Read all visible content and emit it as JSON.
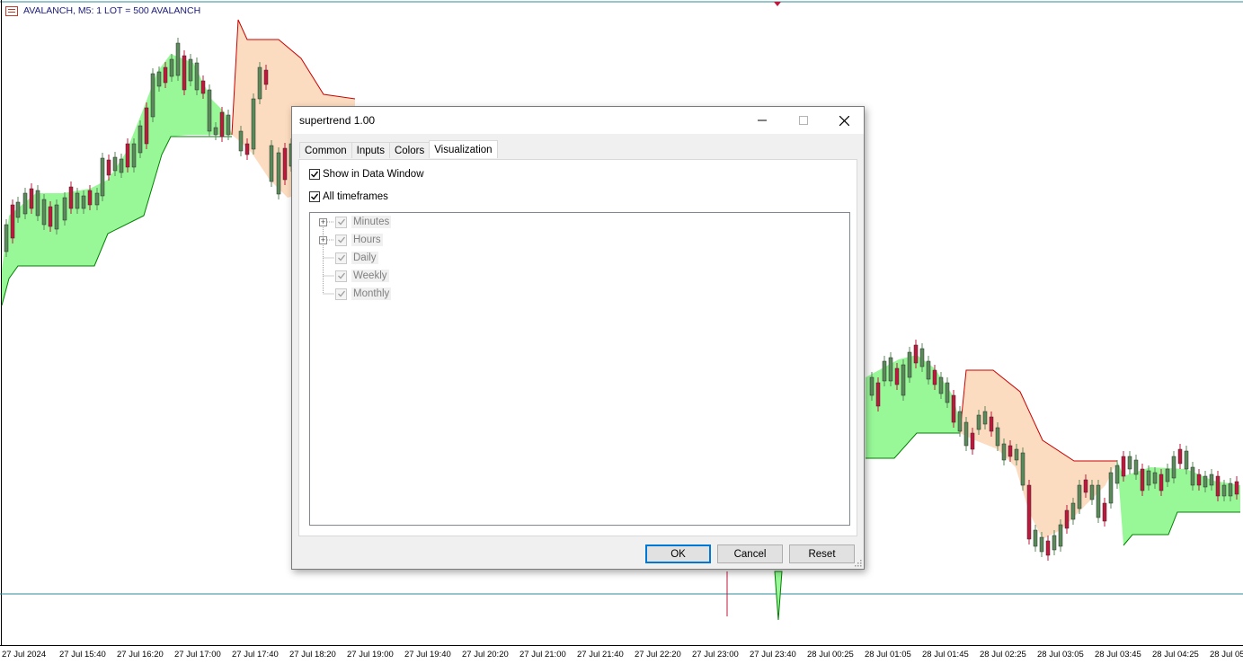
{
  "chart": {
    "title": "AVALANCH, M5:  1 LOT = 500 AVALANCH",
    "time_labels": [
      "27 Jul 2024",
      "27 Jul 15:40",
      "27 Jul 16:20",
      "27 Jul 17:00",
      "27 Jul 17:40",
      "27 Jul 18:20",
      "27 Jul 19:00",
      "27 Jul 19:40",
      "27 Jul 20:20",
      "27 Jul 21:00",
      "27 Jul 21:40",
      "27 Jul 22:20",
      "27 Jul 23:00",
      "27 Jul 23:40",
      "28 Jul 00:25",
      "28 Jul 01:05",
      "28 Jul 01:45",
      "28 Jul 02:25",
      "28 Jul 03:05",
      "28 Jul 03:45",
      "28 Jul 04:25",
      "28 Jul 05"
    ],
    "colors": {
      "up_band": "#98f898",
      "down_band": "#fcdcc0",
      "down_line": "#cc0000",
      "up_line": "#008000",
      "bull_candle": "#5a8a5a",
      "bear_candle": "#c0183c",
      "grid_line": "#2e8b9a"
    }
  },
  "dialog": {
    "title": "supertrend 1.00",
    "tabs": [
      "Common",
      "Inputs",
      "Colors",
      "Visualization"
    ],
    "active_tab": "Visualization",
    "show_in_data_window": {
      "label": "Show in Data Window",
      "checked": true
    },
    "all_timeframes": {
      "label": "All timeframes",
      "checked": true
    },
    "timeframes": [
      {
        "label": "Minutes",
        "expandable": true,
        "checked": true
      },
      {
        "label": "Hours",
        "expandable": true,
        "checked": true
      },
      {
        "label": "Daily",
        "expandable": false,
        "checked": true
      },
      {
        "label": "Weekly",
        "expandable": false,
        "checked": true
      },
      {
        "label": "Monthly",
        "expandable": false,
        "checked": true
      }
    ],
    "buttons": {
      "ok": "OK",
      "cancel": "Cancel",
      "reset": "Reset"
    }
  }
}
